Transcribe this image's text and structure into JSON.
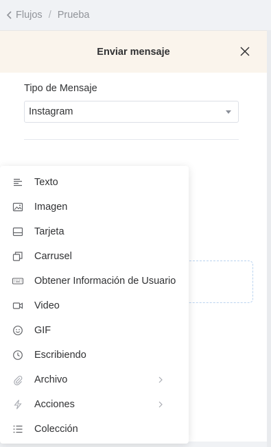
{
  "breadcrumb": {
    "items": [
      "Flujos",
      "Prueba"
    ],
    "separator": "/"
  },
  "drawer": {
    "title": "Enviar mensaje",
    "field_label": "Tipo de Mensaje",
    "select_value": "Instagram"
  },
  "menu": {
    "items": [
      {
        "label": "Texto",
        "icon": "text-lines-icon",
        "has_submenu": false
      },
      {
        "label": "Imagen",
        "icon": "image-icon",
        "has_submenu": false
      },
      {
        "label": "Tarjeta",
        "icon": "card-icon",
        "has_submenu": false
      },
      {
        "label": "Carrusel",
        "icon": "carousel-icon",
        "has_submenu": false
      },
      {
        "label": "Obtener Información de Usuario",
        "icon": "keyboard-icon",
        "has_submenu": false
      },
      {
        "label": "Video",
        "icon": "video-camera-icon",
        "has_submenu": false
      },
      {
        "label": "GIF",
        "icon": "smiley-icon",
        "has_submenu": false
      },
      {
        "label": "Escribiendo",
        "icon": "clock-icon",
        "has_submenu": false
      },
      {
        "label": "Archivo",
        "icon": "paperclip-icon",
        "has_submenu": true
      },
      {
        "label": "Acciones",
        "icon": "lightning-icon",
        "has_submenu": true
      },
      {
        "label": "Colección",
        "icon": "list-icon",
        "has_submenu": false
      }
    ]
  },
  "colors": {
    "header_bg": "#faf4ec",
    "page_bg": "#f0f2f5",
    "text": "#303133",
    "muted": "#909399",
    "dashed_border": "#b9d3f0"
  }
}
